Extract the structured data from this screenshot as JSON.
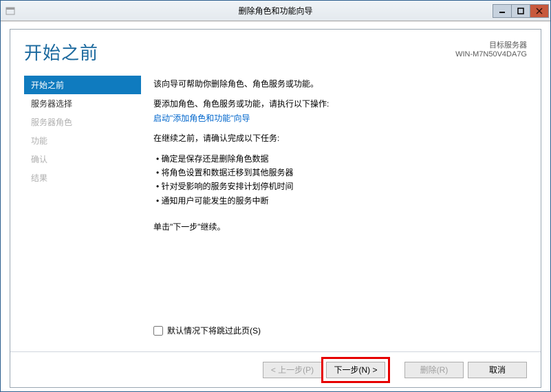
{
  "window": {
    "title": "删除角色和功能向导"
  },
  "header": {
    "page_title": "开始之前",
    "target_label": "目标服务器",
    "target_name": "WIN-M7N50V4DA7G"
  },
  "sidebar": {
    "steps": [
      {
        "label": "开始之前",
        "state": "active"
      },
      {
        "label": "服务器选择",
        "state": "enabled"
      },
      {
        "label": "服务器角色",
        "state": "disabled"
      },
      {
        "label": "功能",
        "state": "disabled"
      },
      {
        "label": "确认",
        "state": "disabled"
      },
      {
        "label": "结果",
        "state": "disabled"
      }
    ]
  },
  "main": {
    "intro": "该向导可帮助你删除角色、角色服务或功能。",
    "add_text": "要添加角色、角色服务或功能，请执行以下操作:",
    "add_link": "启动\"添加角色和功能\"向导",
    "before_text": "在继续之前，请确认完成以下任务:",
    "tasks": [
      "确定是保存还是删除角色数据",
      "将角色设置和数据迁移到其他服务器",
      "针对受影响的服务安排计划停机时间",
      "通知用户可能发生的服务中断"
    ],
    "continue_text": "单击\"下一步\"继续。",
    "skip_label": "默认情况下将跳过此页(S)"
  },
  "footer": {
    "prev": "< 上一步(P)",
    "next": "下一步(N) >",
    "remove": "删除(R)",
    "cancel": "取消"
  }
}
